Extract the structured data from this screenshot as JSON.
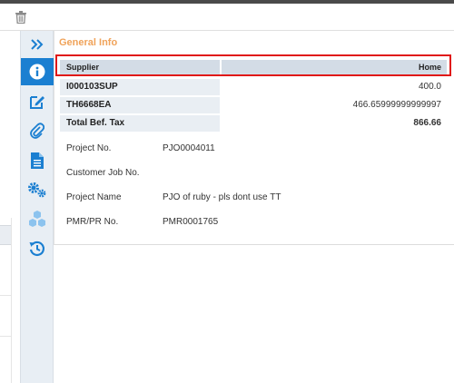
{
  "toolbar": {
    "delete_icon": "trash-icon"
  },
  "rail": {
    "items": [
      {
        "icon": "double-chevron-right-icon"
      },
      {
        "icon": "info-icon",
        "active": true
      },
      {
        "icon": "edit-icon"
      },
      {
        "icon": "paperclip-icon"
      },
      {
        "icon": "document-icon"
      },
      {
        "icon": "gears-icon"
      },
      {
        "icon": "cubes-icon"
      },
      {
        "icon": "history-icon"
      }
    ]
  },
  "panel": {
    "title": "General Info",
    "table": {
      "headers": [
        "Supplier",
        "Home"
      ],
      "rows": [
        {
          "label": "I000103SUP",
          "value": "400.0"
        },
        {
          "label": "TH6668EA",
          "value": "466.65999999999997"
        },
        {
          "label": "Total Bef. Tax",
          "value": "866.66"
        }
      ]
    },
    "fields": [
      {
        "label": "Project No.",
        "value": "PJO0004011"
      },
      {
        "label": "Customer Job No.",
        "value": ""
      },
      {
        "label": "Project Name",
        "value": "PJO of ruby - pls dont use TT"
      },
      {
        "label": "PMR/PR No.",
        "value": "PMR0001765"
      }
    ]
  },
  "colors": {
    "accent": "#1b7fd1",
    "title": "#f0a35a",
    "highlight": "#e01818",
    "header_bg": "#d3dce6"
  }
}
